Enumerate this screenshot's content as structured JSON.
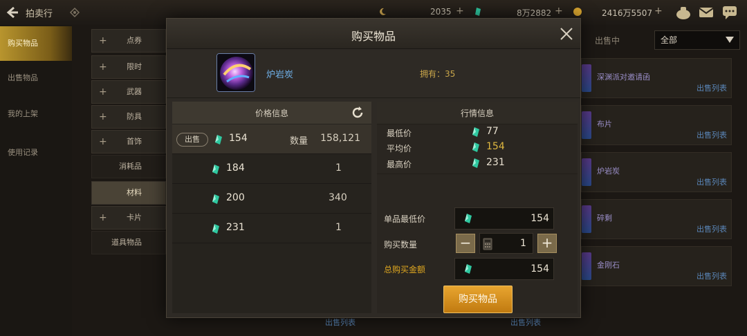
{
  "app": {
    "title": "拍卖行",
    "currencies": [
      {
        "icon": "moon-coin-icon",
        "value": "2035"
      },
      {
        "icon": "gem-icon",
        "value": "8万2882"
      },
      {
        "icon": "gold-coin-icon",
        "value": "2416万5507"
      }
    ]
  },
  "sidebar": {
    "items": [
      {
        "label": "购买物品",
        "active": true
      },
      {
        "label": "出售物品",
        "active": false
      },
      {
        "label": "我的上架",
        "active": false
      },
      {
        "label": "使用记录",
        "active": false
      }
    ]
  },
  "categories": [
    {
      "label": "点券",
      "expandable": true
    },
    {
      "label": "限时",
      "expandable": true
    },
    {
      "label": "武器",
      "expandable": true
    },
    {
      "label": "防具",
      "expandable": true
    },
    {
      "label": "首饰",
      "expandable": true
    },
    {
      "label": "消耗品",
      "expandable": false
    },
    {
      "label": "材料",
      "expandable": false,
      "active": true
    },
    {
      "label": "卡片",
      "expandable": true
    },
    {
      "label": "道具物品",
      "expandable": false
    }
  ],
  "filter": {
    "label": "出售中",
    "selected": "全部"
  },
  "bg_rows": [
    {
      "name": "深渊派对邀请函",
      "sell": "出售列表"
    },
    {
      "name": "布片",
      "sell": "出售列表"
    },
    {
      "name": "炉岩炭",
      "sell": "出售列表"
    },
    {
      "name": "碎剩",
      "sell": "出售列表"
    },
    {
      "name": "金刚石",
      "sell": "出售列表"
    }
  ],
  "bg_bottom_sell": "出售列表",
  "modal": {
    "title": "购买物品",
    "item_name": "炉岩炭",
    "owned": "拥有：35",
    "price_header": "价格信息",
    "market_header": "行情信息",
    "sell_tag": "出售",
    "qty_label": "数量",
    "price_rows": [
      {
        "price": "154",
        "qty": "158,121"
      },
      {
        "price": "184",
        "qty": "1"
      },
      {
        "price": "200",
        "qty": "340"
      },
      {
        "price": "231",
        "qty": "1"
      }
    ],
    "market": {
      "min_label": "最低价",
      "min_value": "77",
      "avg_label": "平均价",
      "avg_value": "154",
      "max_label": "最高价",
      "max_value": "231"
    },
    "form": {
      "unit_price_label": "单品最低价",
      "unit_price": "154",
      "qty_label": "购买数量",
      "qty": "1",
      "total_label": "总购买金额",
      "total": "154"
    },
    "buy_button": "购买物品"
  }
}
